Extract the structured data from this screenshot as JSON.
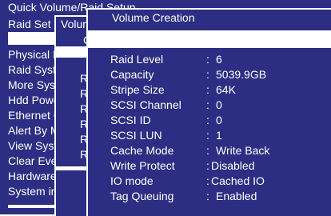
{
  "main_menu": {
    "items": [
      "Quick Volume/Raid Setup",
      "Raid Set Function"
    ],
    "lower_items": [
      "Physical Drives",
      "Raid System Function",
      "More System Functions",
      "Hdd Power Management",
      "Ethernet Configuration",
      "Alert By Mail Config",
      "View System Events",
      "Clear Event Buffer",
      "Hardware Monitor",
      "System information"
    ]
  },
  "volume_set_functions": {
    "title": "Volume Set Functions",
    "item_initial": "C",
    "letters": [
      "R",
      "R",
      "R",
      "R",
      "R",
      "R"
    ]
  },
  "volume_creation": {
    "title": "Volume Creation",
    "fields": [
      {
        "label": "Raid Level",
        "sep": ":",
        "value": "6"
      },
      {
        "label": "Capacity",
        "sep": ":",
        "value": "5039.9GB"
      },
      {
        "label": "Stripe Size",
        "sep": ":",
        "value": "64K"
      },
      {
        "label": "SCSI Channel",
        "sep": ":",
        "value": "0"
      },
      {
        "label": "SCSI ID",
        "sep": ":",
        "value": "0"
      },
      {
        "label": "SCSI LUN",
        "sep": ":",
        "value": "1"
      },
      {
        "label": "Cache Mode",
        "sep": ":",
        "value": "Write Back"
      },
      {
        "label": "Write Protect",
        "sep": ":",
        "value": "Disabled"
      },
      {
        "label": "IO mode",
        "sep": ":",
        "value": "Cached IO"
      },
      {
        "label": "Tag Queuing",
        "sep": ":",
        "value": "Enabled"
      }
    ]
  },
  "colors": {
    "panel": "#2b2e82",
    "text": "#ffffff",
    "highlight": "#ffffff"
  }
}
